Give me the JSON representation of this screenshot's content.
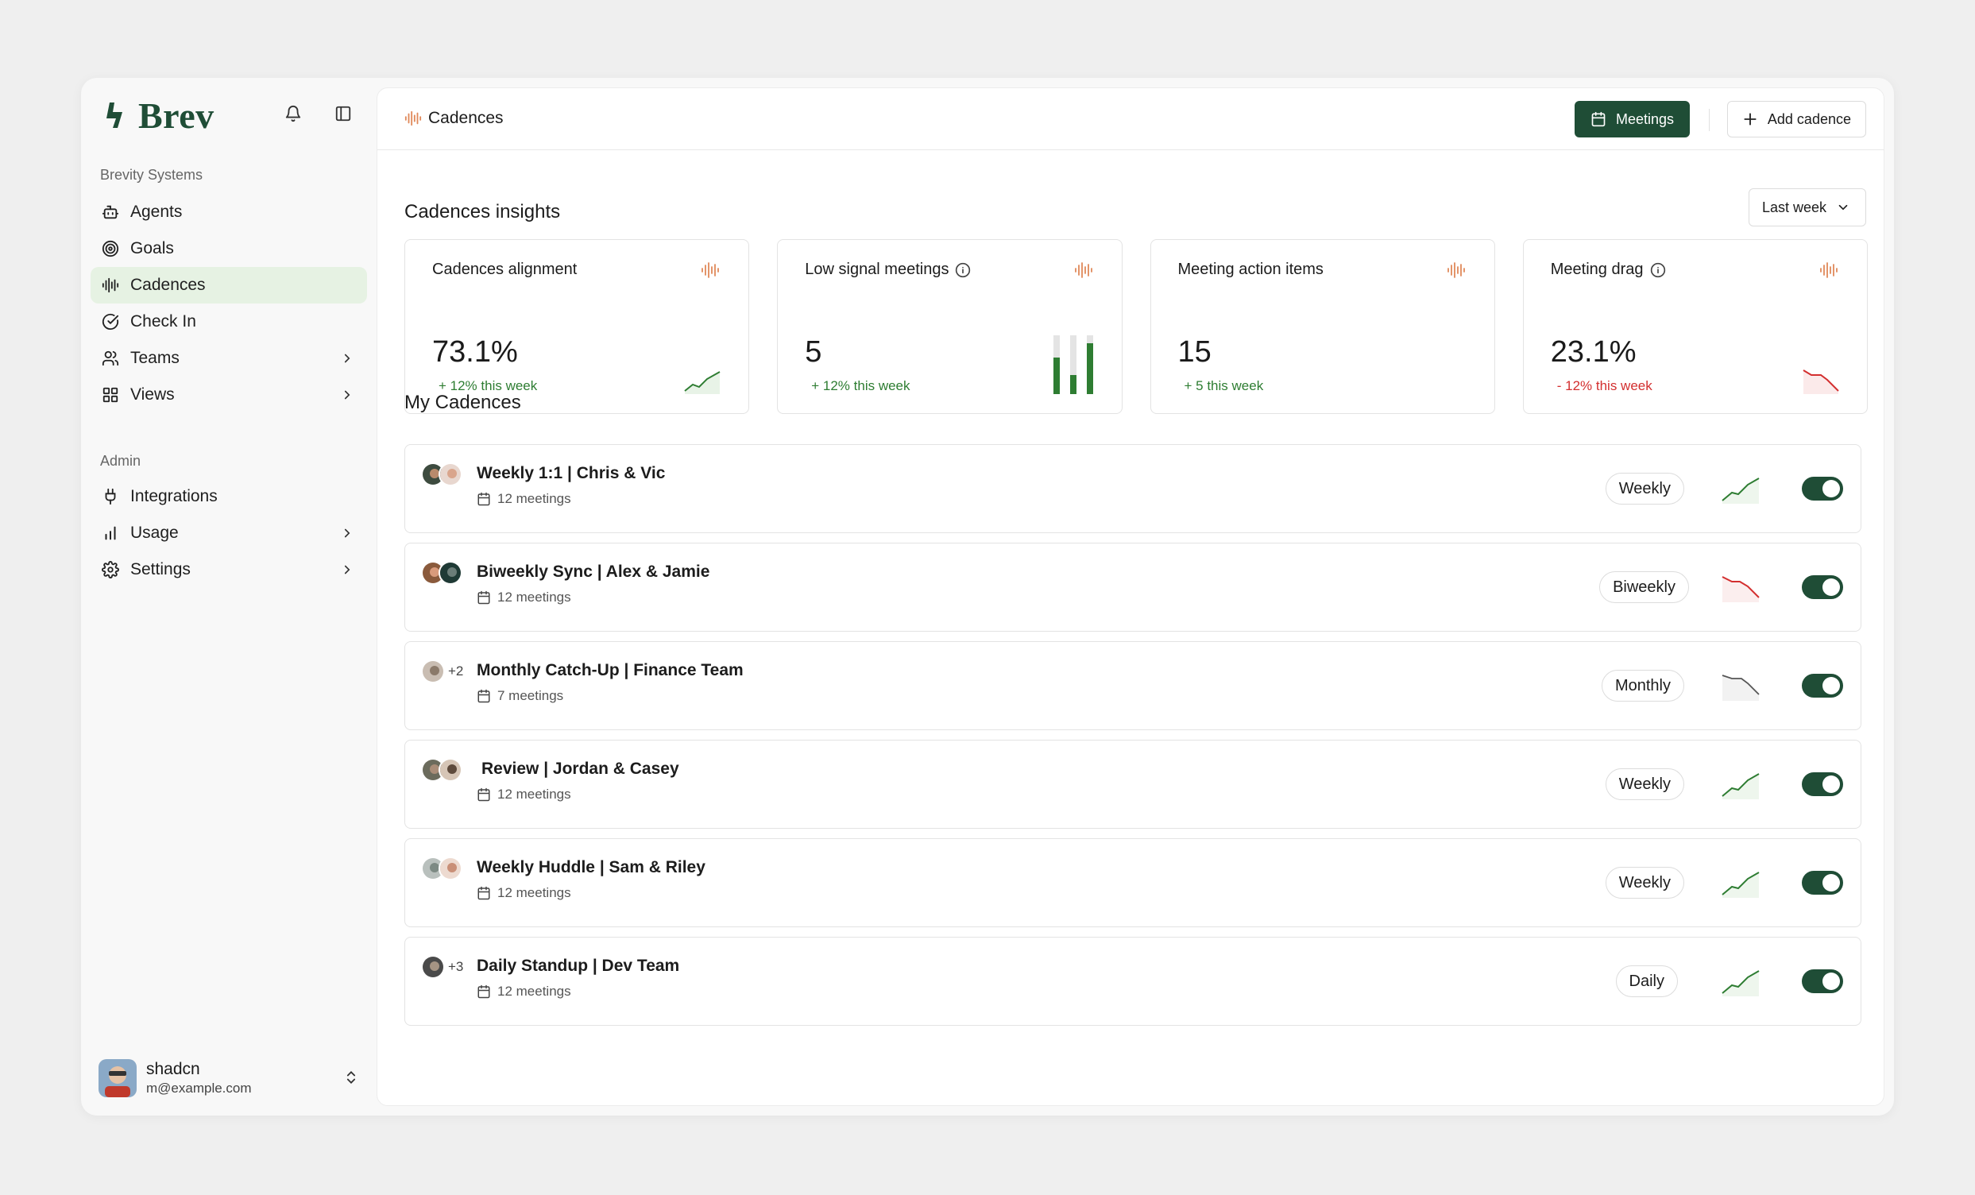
{
  "brand": {
    "name": "Brev",
    "color": "#1f4d36"
  },
  "sidebar": {
    "workspace_label": "Brevity Systems",
    "items": [
      {
        "label": "Agents",
        "icon": "bot-icon"
      },
      {
        "label": "Goals",
        "icon": "target-icon"
      },
      {
        "label": "Cadences",
        "icon": "waveform-icon",
        "active": true
      },
      {
        "label": "Check In",
        "icon": "check-circle-icon"
      },
      {
        "label": "Teams",
        "icon": "users-icon",
        "chevron": true
      },
      {
        "label": "Views",
        "icon": "grid-icon",
        "chevron": true
      }
    ],
    "admin_label": "Admin",
    "admin_items": [
      {
        "label": "Integrations",
        "icon": "plug-icon"
      },
      {
        "label": "Usage",
        "icon": "bar-chart-icon",
        "chevron": true
      },
      {
        "label": "Settings",
        "icon": "gear-icon",
        "chevron": true
      }
    ],
    "user": {
      "name": "shadcn",
      "email": "m@example.com"
    }
  },
  "header": {
    "breadcrumb": "Cadences",
    "meetings_button": "Meetings",
    "add_button": "Add cadence"
  },
  "insights": {
    "title": "Cadences insights",
    "period": "Last week",
    "cards": [
      {
        "title": "Cadences alignment",
        "value": "73.1%",
        "delta": "+ 12% this week",
        "trend": "up"
      },
      {
        "title": "Low signal meetings",
        "value": "5",
        "delta": "+ 12% this week",
        "trend": "up",
        "info": true
      },
      {
        "title": "Meeting action items",
        "value": "15",
        "delta": "+ 5 this week",
        "trend": "up"
      },
      {
        "title": "Meeting drag",
        "value": "23.1%",
        "delta": "- 12% this week",
        "trend": "down",
        "info": true
      }
    ]
  },
  "cadences": {
    "title": "My Cadences",
    "rows": [
      {
        "title": "Weekly 1:1 | Chris & Vic",
        "meetings": "12 meetings",
        "frequency": "Weekly",
        "trend": "up",
        "enabled": true,
        "extra": ""
      },
      {
        "title": "Biweekly Sync | Alex & Jamie",
        "meetings": "12 meetings",
        "frequency": "Biweekly",
        "trend": "down",
        "enabled": true,
        "extra": ""
      },
      {
        "title": "Monthly Catch-Up | Finance Team",
        "meetings": "7 meetings",
        "frequency": "Monthly",
        "trend": "flat-down",
        "enabled": true,
        "extra": "+2"
      },
      {
        "title": "Review | Jordan & Casey",
        "meetings": "12 meetings",
        "frequency": "Weekly",
        "trend": "up",
        "enabled": true,
        "extra": ""
      },
      {
        "title": "Weekly Huddle | Sam & Riley",
        "meetings": "12 meetings",
        "frequency": "Weekly",
        "trend": "up",
        "enabled": true,
        "extra": ""
      },
      {
        "title": "Daily Standup | Dev Team",
        "meetings": "12 meetings",
        "frequency": "Daily",
        "trend": "up",
        "enabled": true,
        "extra": "+3"
      }
    ]
  },
  "colors": {
    "accent": "#1f4d36",
    "positive": "#2e7d32",
    "negative": "#d32f2f",
    "wave": "#e0895a"
  }
}
